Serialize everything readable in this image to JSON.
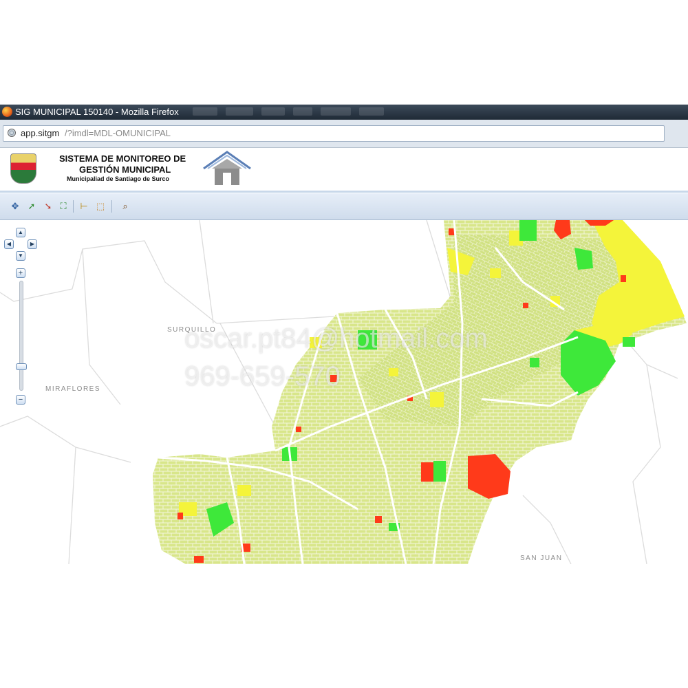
{
  "window": {
    "title": "SIG MUNICIPAL 150140 - Mozilla Firefox"
  },
  "address_bar": {
    "host": "app.sitgm",
    "path": "/?imdl=MDL-OMUNICIPAL"
  },
  "app_header": {
    "line1": "SISTEMA DE MONITOREO DE",
    "line2": "GESTIÓN MUNICIPAL",
    "line3": "Municipaliad de Santiago de Surco"
  },
  "toolbar": {
    "icons": [
      "pan-icon",
      "zoom-in-arrow-icon",
      "zoom-out-arrow-icon",
      "full-extent-icon",
      "measure-icon",
      "select-icon",
      "identify-icon"
    ]
  },
  "map": {
    "districts": {
      "surquillo": "SURQUILLO",
      "miraflores": "MIRAFLORES",
      "san_juan": "SAN JUAN"
    },
    "watermark_line1": "oscar.pt84@hotmail.com",
    "watermark_line2": "969-659-570",
    "legend_colors": {
      "low": "#d8e68a",
      "medium": "#f4f43a",
      "good": "#3ee83a",
      "critical": "#ff3a1a"
    }
  },
  "nav_control": {
    "pan_up": "▲",
    "pan_left": "◀",
    "pan_right": "▶",
    "pan_down": "▼",
    "zoom_in": "+",
    "zoom_out": "−"
  }
}
